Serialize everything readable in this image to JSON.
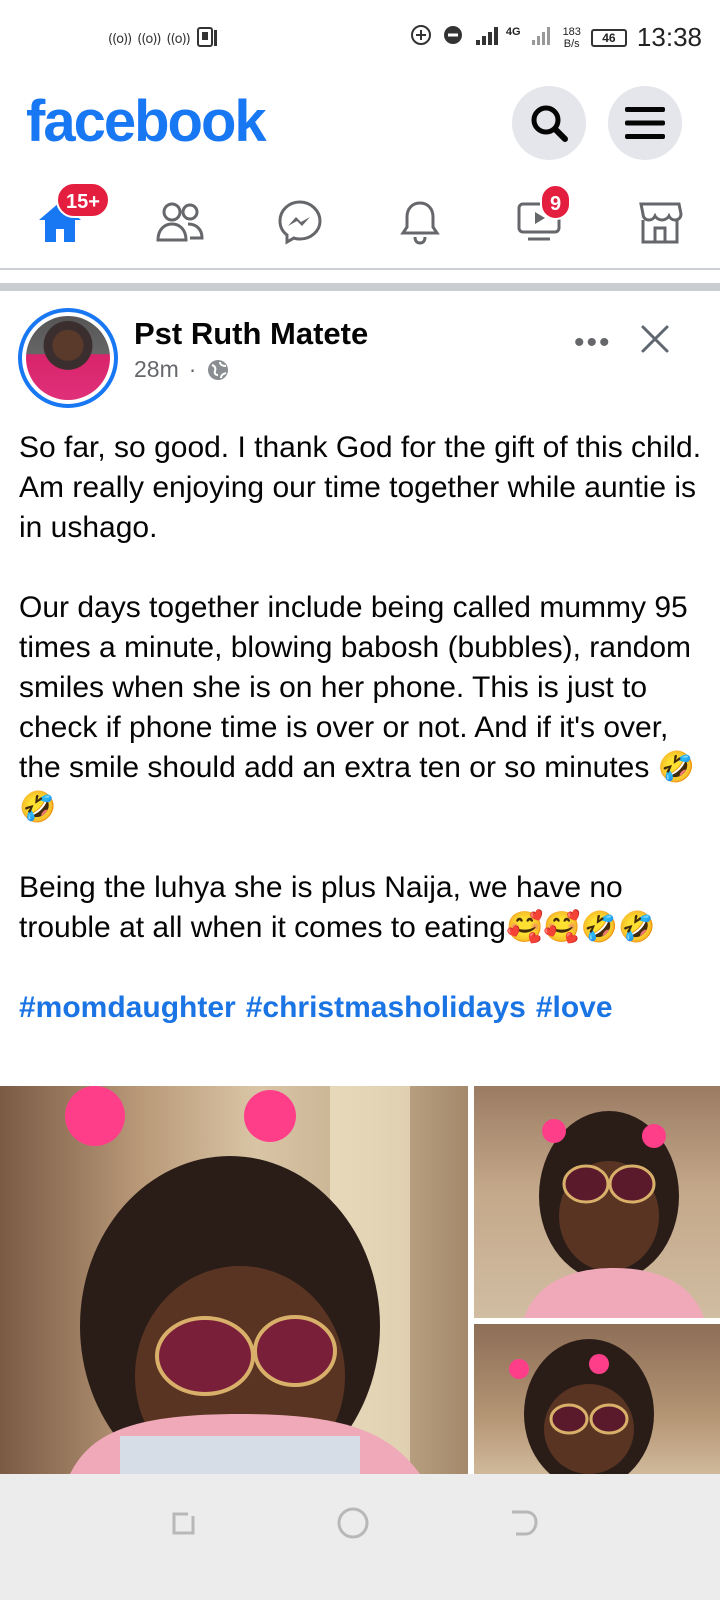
{
  "status_bar": {
    "left_icons": [
      "hotspot-icon",
      "hotspot-icon",
      "hotspot-icon",
      "sim-manager-icon"
    ],
    "net_speed_value": "183",
    "net_speed_unit": "B/s",
    "network": "4G",
    "battery": "46",
    "time": "13:38"
  },
  "header": {
    "logo": "facebook",
    "brand_color": "#1877f2"
  },
  "nav": {
    "home_badge": "15+",
    "video_badge": "9"
  },
  "post": {
    "author": "Pst Ruth Matete",
    "time": "28m",
    "separator": "·",
    "more": "•••",
    "paragraphs": [
      "So far, so good. I thank God for the gift of this child. Am really enjoying our time together while auntie is in ushago.",
      "Our days together include being called mummy 95 times a minute, blowing babosh (bubbles), random smiles when she is on her phone. This is just to check if phone time is over or not. And if it's over, the smile should add an extra ten or so minutes 🤣🤣",
      "Being the luhya she is plus Naija, we have no trouble at all when it comes to eating🥰🥰🤣🤣"
    ],
    "hashtags": [
      "#momdaughter",
      "#christmasholidays",
      "#love"
    ]
  }
}
